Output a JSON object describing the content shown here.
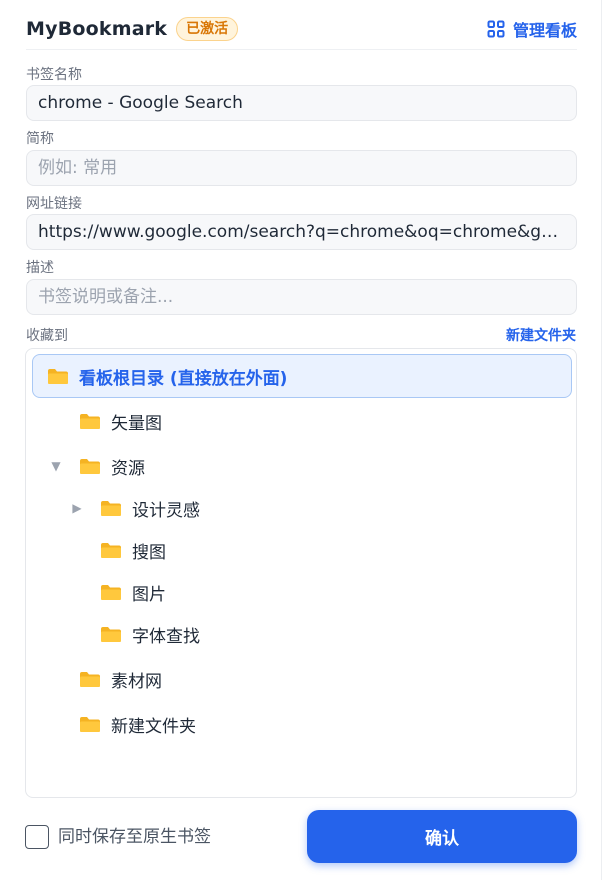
{
  "header": {
    "app_title": "MyBookmark",
    "status_badge": "已激活",
    "manage_board_label": "管理看板"
  },
  "form": {
    "name": {
      "label": "书签名称",
      "value": "chrome - Google Search"
    },
    "short_name": {
      "label": "简称",
      "value": "",
      "placeholder": "例如: 常用"
    },
    "url": {
      "label": "网址链接",
      "value": "https://www.google.com/search?q=chrome&oq=chrome&gs_lcr..."
    },
    "description": {
      "label": "描述",
      "value": "",
      "placeholder": "书签说明或备注..."
    }
  },
  "collect": {
    "label": "收藏到",
    "new_folder_label": "新建文件夹"
  },
  "tree": {
    "root": {
      "label": "看板根目录 (直接放在外面)",
      "selected": true
    },
    "nodes": [
      {
        "label": "矢量图",
        "depth": 1,
        "caret": ""
      },
      {
        "label": "资源",
        "depth": 1,
        "caret": "expanded"
      },
      {
        "label": "设计灵感",
        "depth": 2,
        "caret": "collapsed"
      },
      {
        "label": "搜图",
        "depth": 2,
        "caret": ""
      },
      {
        "label": "图片",
        "depth": 2,
        "caret": ""
      },
      {
        "label": "字体查找",
        "depth": 2,
        "caret": ""
      },
      {
        "label": "素材网",
        "depth": 1,
        "caret": ""
      },
      {
        "label": "新建文件夹",
        "depth": 1,
        "caret": ""
      }
    ]
  },
  "footer": {
    "sync_label": "同时保存至原生书签",
    "sync_checked": false,
    "confirm_label": "确认"
  },
  "colors": {
    "accent": "#2563eb",
    "badge": "#d97706",
    "folder": "#f5b323"
  },
  "icons": {
    "manage": "grid-icon",
    "folder": "folder-icon",
    "caret_expanded": "caret-down-icon",
    "caret_collapsed": "caret-right-icon"
  }
}
